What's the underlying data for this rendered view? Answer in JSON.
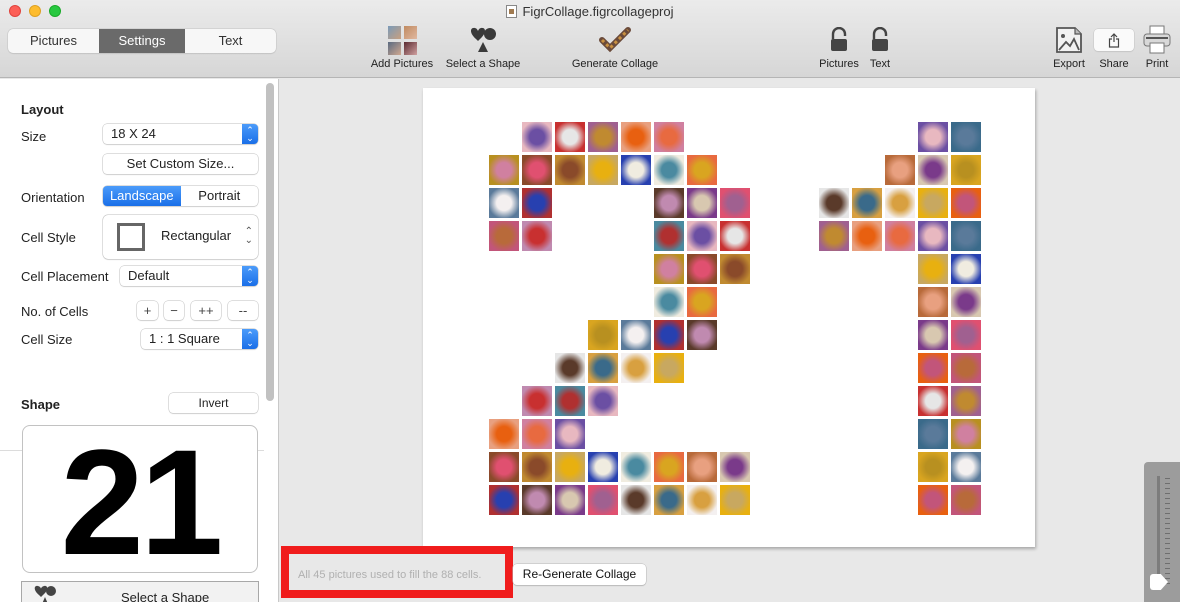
{
  "window": {
    "title": "FigrCollage.figrcollageproj",
    "controls": [
      "close",
      "minimize",
      "zoom"
    ]
  },
  "toolbar": {
    "segments": [
      {
        "label": "Pictures",
        "active": false
      },
      {
        "label": "Settings",
        "active": true
      },
      {
        "label": "Text",
        "active": false
      }
    ],
    "add_pictures": {
      "label": "Add Pictures",
      "icon": "photo-grid-icon"
    },
    "select_shape": {
      "label": "Select a Shape",
      "icon": "shapes-icon"
    },
    "generate_collage": {
      "label": "Generate Collage",
      "icon": "collage-check-icon"
    },
    "lock_pictures": {
      "label": "Pictures",
      "icon": "unlocked-padlock-icon"
    },
    "lock_text": {
      "label": "Text",
      "icon": "unlocked-padlock-icon"
    },
    "export": {
      "label": "Export",
      "icon": "image-export-icon"
    },
    "share": {
      "label": "Share",
      "icon": "share-icon"
    },
    "print": {
      "label": "Print",
      "icon": "printer-icon"
    }
  },
  "sidebar": {
    "layout": {
      "title": "Layout",
      "size_label": "Size",
      "size_value": "18 X 24",
      "custom_size_button": "Set Custom Size...",
      "orientation_label": "Orientation",
      "orientation_options": [
        "Landscape",
        "Portrait"
      ],
      "orientation_selected": "Landscape",
      "cell_style_label": "Cell Style",
      "cell_style_value": "Rectangular",
      "cell_placement_label": "Cell Placement",
      "cell_placement_value": "Default",
      "num_cells_label": "No. of Cells",
      "num_cells_buttons": [
        "+",
        "−",
        "++",
        "--"
      ],
      "cell_size_label": "Cell Size",
      "cell_size_value": "1 : 1 Square"
    },
    "shape": {
      "title": "Shape",
      "invert_button": "Invert",
      "preview_text": "21",
      "select_shape_button": "Select a Shape"
    }
  },
  "canvas": {
    "total_cells": 88,
    "shape_text": "21",
    "palette": [
      "#6b4fa3",
      "#d9a520",
      "#c2557a",
      "#8a4a2a",
      "#5a3a2a",
      "#e8b8c0",
      "#2740b0",
      "#e6e6e6",
      "#e8a080",
      "#b86a3a",
      "#e8b010",
      "#3a6a8a",
      "#5a7a9a",
      "#c08ab0",
      "#c08a30",
      "#7a3a8a",
      "#c83030",
      "#f0ece0",
      "#d8a040",
      "#d080a0",
      "#d8c8b0",
      "#e86010",
      "#b89020",
      "#b03030",
      "#4a8aa0",
      "#c8a860",
      "#e05070",
      "#a06090",
      "#e86a40",
      "#f4f0f0"
    ]
  },
  "status": {
    "message": "All 45 pictures used to fill the 88 cells.",
    "regenerate_button": "Re-Generate Collage"
  },
  "zoom_slider": {
    "value_fraction": 0.0
  }
}
